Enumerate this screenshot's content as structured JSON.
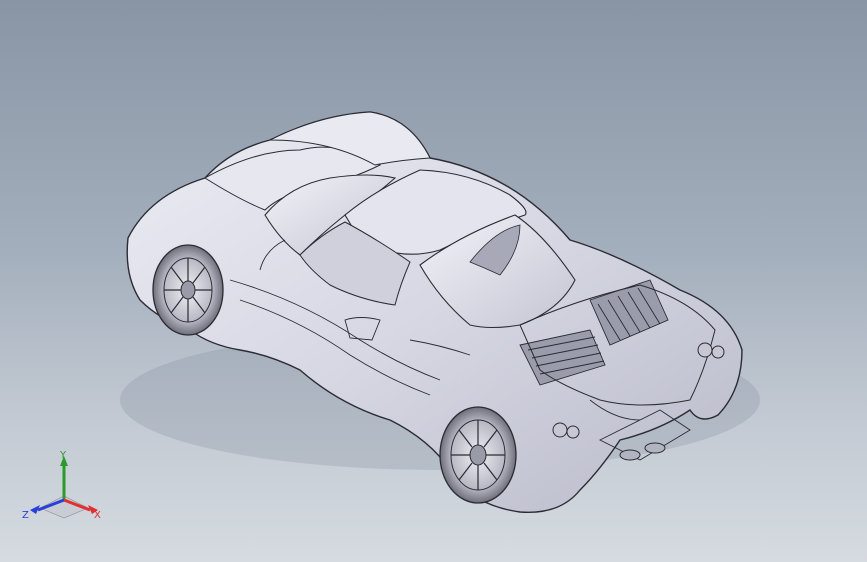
{
  "colors": {
    "background_top": "#8995a5",
    "background_bottom": "#d6dbe1",
    "model_fill": "#dcdde8",
    "model_edge": "#2b2b33",
    "axis_x": "#e03030",
    "axis_y": "#2a9a2a",
    "axis_z": "#2a3fd6"
  },
  "triad": {
    "x_label": "X",
    "y_label": "Y",
    "z_label": "Z"
  }
}
